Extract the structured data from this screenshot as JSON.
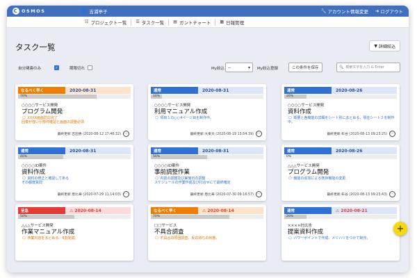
{
  "app": {
    "logo_text": "OSMOS",
    "logo_letter": "C"
  },
  "header": {
    "user_name": "吉浦亭子",
    "account_link": "アカウント情報変更",
    "logout_link": "ログアウト"
  },
  "nav": [
    "プロジェクト一覧",
    "タスク一覧",
    "ガントチャート",
    "日報管理"
  ],
  "page": {
    "title": "タスク一覧",
    "detail_button": "詳細絞込"
  },
  "filters": {
    "self_only_label": "自分関連のみ",
    "overdue_label": "期限切れ",
    "my_filter_label": "My絞込",
    "my_filter_value": "--",
    "my_filter_register_label": "My絞込登録",
    "save_condition_button": "この条件を保存",
    "search_placeholder": "検索文字を入力 & Enter"
  },
  "colors": {
    "header_blue": "#3f6fbd",
    "orange": "#f07c00",
    "orange_light": "#fde3cc",
    "blue": "#2f6fd6",
    "blue_light": "#dbe6f8",
    "red": "#e53935",
    "red_light": "#fadada",
    "link_blue": "#2e6fd0",
    "warn_orange": "#e07000",
    "fab_yellow": "#f5d90a"
  },
  "cards": [
    {
      "priority": "なるべく早く",
      "priority_color": "orange",
      "warn": false,
      "date": "2020-08-31",
      "progress": "70%",
      "progress_value": 70,
      "client": "○○○○サービス開発",
      "title": "プログラム開発",
      "note_color": "orange",
      "note_icon": "comment-icon",
      "note": "XXXX画面対応完了\n回復が強いか部件確認と画面の調整必須",
      "updated": "最終更新:吉田秀 (2020-08-12 17:46:32)"
    },
    {
      "priority": "通常",
      "priority_color": "blue",
      "warn": false,
      "date": "2020-08-31",
      "progress": "10%",
      "progress_value": 10,
      "client": "○○○○サービス開発",
      "title": "利用マニュアル作成",
      "note_color": "blue",
      "note_icon": "comment-icon",
      "note": "項目１の○○4ページ目を制作中。",
      "updated": "最終更新:大東天 (2020-08-19 13:54:39)"
    },
    {
      "priority": "通常",
      "priority_color": "blue",
      "warn": false,
      "date": "2020-08-26",
      "progress": "20%",
      "progress_value": 20,
      "client": "○○○○サービス開発",
      "title": "資料作成",
      "note_color": "blue",
      "note_icon": "comment-icon",
      "note": "概要と各機能の詳細をシート別にまとめる、現在シート３を制作中。",
      "updated": "最終更新:布谷 (2020-08-13 09:23:25)"
    },
    {
      "priority": "通常",
      "priority_color": "blue",
      "warn": false,
      "date": "2020-08-31",
      "progress": "40%",
      "progress_value": 40,
      "client": "○○○○ID案件",
      "title": "資料作成",
      "note_color": "blue",
      "note_icon": "comment-icon",
      "note": "資料の修正と確認してある\nその都度質問",
      "updated": "最終更新:恵比寿 (2020-07-29 11:14:03)"
    },
    {
      "priority": "通常",
      "priority_color": "blue",
      "warn": false,
      "date": "2020-08-31",
      "progress": "50%",
      "progress_value": 50,
      "client": "○○○○ID案件",
      "title": "事前調整作業",
      "note_color": "blue",
      "note_icon": "comment-icon",
      "note": "内容の調整及び実施日の調整\nスケジュールの作業作成及び打合せにて最終確定",
      "updated": "最終更新:恵比寿 (2020-07-30 09:16:57)"
    },
    {
      "priority": "通常",
      "priority_color": "blue",
      "warn": false,
      "date": "2020-08-26",
      "progress": "0%",
      "progress_value": 0,
      "client": "△△△サービス開発",
      "title": "プログラム開発",
      "note_color": "blue",
      "note_icon": "comment-icon",
      "note": "機能の追加による既存機能の変更",
      "updated": "最終更新:布谷 (2020-08-13 09:23:43)"
    },
    {
      "priority": "至急",
      "priority_color": "red",
      "warn": true,
      "date": "2020-08-14",
      "progress": "50%",
      "progress_value": 50,
      "client": "△△△サービス開発",
      "title": "作業マニュアル作成",
      "note_color": "orange",
      "note_icon": "comment-icon",
      "note": "作業内容をまとめる、8割完成。",
      "updated": ""
    },
    {
      "priority": "なるべく早く",
      "priority_color": "orange",
      "warn": true,
      "date": "2020-08-14",
      "progress": "70%",
      "progress_value": 70,
      "client": "□□サービス",
      "title": "不具合調査",
      "note_color": "orange",
      "note_icon": "comment-icon",
      "note": "不具合の原因調査、反応待ちの状態。",
      "updated": ""
    },
    {
      "priority": "通常",
      "priority_color": "blue",
      "warn": true,
      "date": "2020-08-21",
      "progress": "20%",
      "progress_value": 20,
      "client": "××××社広告",
      "title": "提案資料作成",
      "note_color": "blue",
      "note_icon": "comment-icon",
      "note": "パワーポイントで作成、メリハリをつけて制作。",
      "updated": ""
    }
  ],
  "fab_label": "+"
}
